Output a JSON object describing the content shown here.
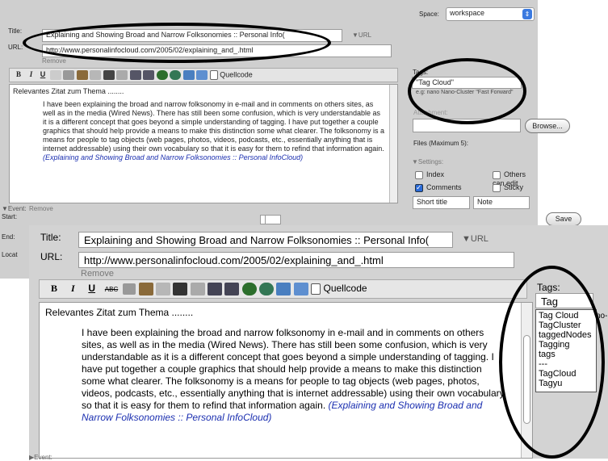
{
  "back": {
    "space_label": "Space:",
    "space_value": "workspace",
    "title_label": "Title:",
    "title_value": "Explaining and Showing Broad and Narrow Folksonomies :: Personal Info(",
    "url_toggle": "▼URL",
    "url_label": "URL:",
    "url_value": "http://www.personalinfocloud.com/2005/02/explaining_and_.html",
    "remove_label": "Remove",
    "toolbar": {
      "bold": "B",
      "italic": "I",
      "underline": "U",
      "source_label": "Quellcode"
    },
    "editor": {
      "heading": "Relevantes Zitat zum Thema ........",
      "body": "I have been explaining the broad and narrow folksonomy in e-mail and in comments on others sites, as well as in the media (Wired News). There has still been some confusion, which is very understandable as it is a different concept that goes beyond a simple understanding of tagging. I have put together a couple graphics that should help provide a means to make this distinction some what clearer. The folksonomy is a means for people to tag objects (web pages, photos, videos, podcasts, etc., essentially anything that is internet addressable) using their own vocabulary so that it is easy for them to refind that information again.",
      "link": "(Explaining and Showing Broad and Narrow Folksonomies :: Personal InfoCloud)"
    },
    "tags_label": "Tags:",
    "tags_value": "\"Tag Cloud\"",
    "tags_hint": "e.g: nano Nano-Cluster \"Fast Forward\"",
    "attachment_label": "Attachment:",
    "browse_button": "Browse...",
    "files_label": "Files (Maximum 5):",
    "settings_label": "▼Settings:",
    "opt_index": "Index",
    "opt_others_can_edit": "Others can edit",
    "opt_comments": "Comments",
    "opt_sticky": "Sticky",
    "short_title_label": "Short title",
    "note_label": "Note",
    "event_label": "▼Event:",
    "event_remove": "Remove",
    "start_label": "Start:",
    "end_label": "End:",
    "location_label": "Locat",
    "save_button": "Save"
  },
  "front": {
    "title_label": "Title:",
    "title_value": "Explaining and Showing Broad and Narrow Folksonomies :: Personal Info(",
    "url_toggle": "▼URL",
    "url_label": "URL:",
    "url_value": "http://www.personalinfocloud.com/2005/02/explaining_and_.html",
    "remove_label": "Remove",
    "toolbar": {
      "bold": "B",
      "italic": "I",
      "underline": "U",
      "abc": "ABC",
      "source_label": "Quellcode"
    },
    "editor": {
      "heading": "Relevantes Zitat zum Thema ........",
      "body": "I have been explaining the broad and narrow folksonomy in e-mail and in comments on others sites, as well as in the media (Wired News). There has still been some confusion, which is very understandable as it is a different concept that goes beyond a simple understanding of tagging. I have put together a couple graphics that should help provide a means to make this distinction some what clearer. The folksonomy is a means for people to tag objects (web pages, photos, videos, podcasts, etc., essentially anything that is internet addressable) using their own vocabulary so that it is easy for them to refind that information again.",
      "link": "(Explaining and Showing Broad and Narrow Folksonomies :: Personal InfoCloud)"
    },
    "event_label": "▶Event:",
    "tags_label": "Tags:",
    "tags_input": "Tag",
    "tags_overflow": "no-",
    "suggestions": [
      "Tag Cloud",
      "TagCluster",
      "taggedNodes",
      "Tagging",
      "tags",
      "---",
      "TagCloud",
      "Tagyu"
    ]
  },
  "colors": {
    "link": "#1b2fb0",
    "panel_bg": "#d3d3d3",
    "checkbox_on": "#2a6ad8",
    "highlight_oval": "#000000"
  }
}
